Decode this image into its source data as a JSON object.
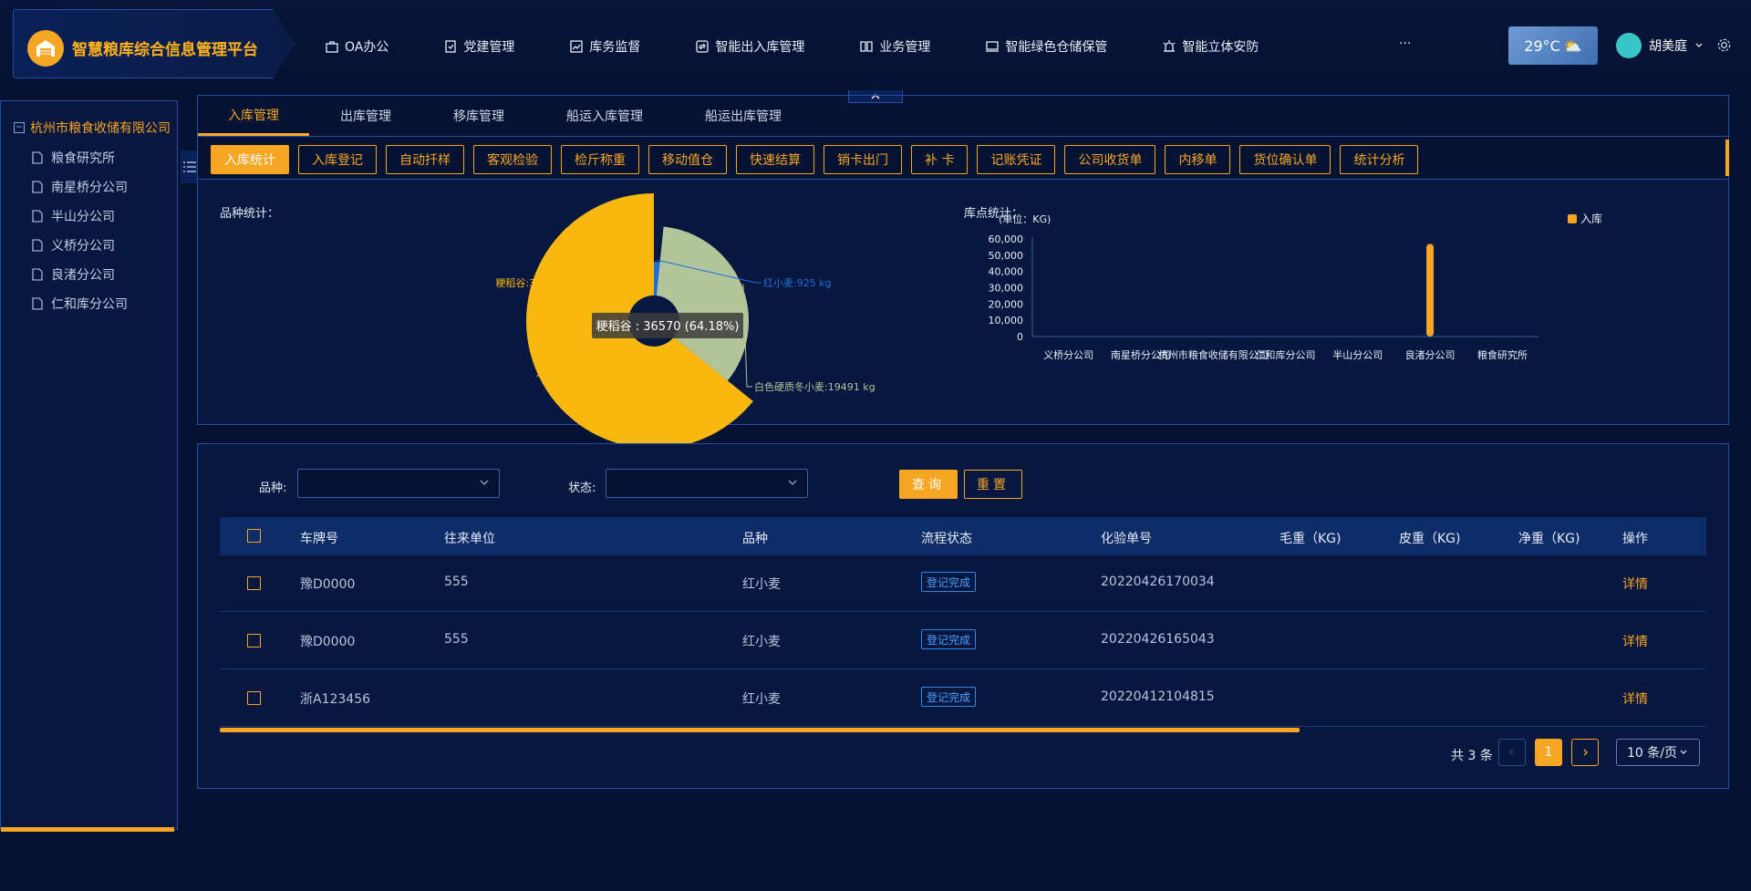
{
  "app": {
    "title": "智慧粮库综合信息管理平台"
  },
  "nav": {
    "items": [
      {
        "label": "OA办公",
        "icon": "briefcase-icon"
      },
      {
        "label": "党建管理",
        "icon": "shield-doc-icon"
      },
      {
        "label": "库务监督",
        "icon": "line-chart-icon"
      },
      {
        "label": "智能出入库管理",
        "icon": "exchange-icon",
        "active": true
      },
      {
        "label": "业务管理",
        "icon": "book-icon"
      },
      {
        "label": "智能绿色仓储保管",
        "icon": "monitor-icon"
      },
      {
        "label": "智能立体安防",
        "icon": "alarm-icon"
      }
    ],
    "more": "···"
  },
  "weather": {
    "temp": "29°C",
    "icon": "partly-cloudy-icon"
  },
  "user": {
    "name": "胡美庭"
  },
  "sidebar": {
    "root": "杭州市粮食收储有限公司",
    "items": [
      "粮食研究所",
      "南星桥分公司",
      "半山分公司",
      "义桥分公司",
      "良渚分公司",
      "仁和库分公司"
    ]
  },
  "tabs": [
    "入库管理",
    "出库管理",
    "移库管理",
    "船运入库管理",
    "船运出库管理"
  ],
  "subtabs": [
    "入库统计",
    "入库登记",
    "自动扦样",
    "客观检验",
    "检斤称重",
    "移动值仓",
    "快速结算",
    "销卡出门",
    "补 卡",
    "记账凭证",
    "公司收货单",
    "内移单",
    "货位确认单",
    "统计分析"
  ],
  "charts": {
    "variety_title": "品种统计：",
    "depot_title": "库点统计：",
    "tooltip": "粳稻谷 : 36570 (64.18%)"
  },
  "chart_data": [
    {
      "type": "pie",
      "title": "品种统计：",
      "slices": [
        {
          "name": "粳稻谷",
          "value": 36570,
          "unit": "kg",
          "color": "#f8b80f"
        },
        {
          "name": "红小麦",
          "value": 925,
          "unit": "kg",
          "color": "#1d6fd6"
        },
        {
          "name": "白色硬质冬小麦",
          "value": 19491,
          "unit": "kg",
          "color": "#b3c49a"
        }
      ]
    },
    {
      "type": "bar",
      "title": "库点统计：",
      "unit_label": "(单位：KG)",
      "legend": [
        "入库"
      ],
      "legend_position": "top-right",
      "categories": [
        "义桥分公司",
        "南星桥分公司",
        "杭州市粮食收储有限公司",
        "仁和库分公司",
        "半山分公司",
        "良渚分公司",
        "粮食研究所"
      ],
      "series": [
        {
          "name": "入库",
          "values": [
            0,
            0,
            0,
            0,
            0,
            56986,
            0
          ],
          "color": "#f6a623"
        }
      ],
      "yticks": [
        "60,000",
        "50,000",
        "40,000",
        "30,000",
        "20,000",
        "10,000",
        "0"
      ],
      "ylim": [
        0,
        60000
      ]
    }
  ],
  "filters": {
    "variety_label": "品种:",
    "status_label": "状态:",
    "query": "查询",
    "reset": "重置"
  },
  "table": {
    "headers": [
      "车牌号",
      "往来单位",
      "品种",
      "流程状态",
      "化验单号",
      "毛重（KG)",
      "皮重（KG)",
      "净重（KG)",
      "操作"
    ],
    "rows": [
      {
        "plate": "豫D0000",
        "unit": "555",
        "variety": "红小麦",
        "status": "登记完成",
        "lab_no": "20220426170034",
        "action": "详情"
      },
      {
        "plate": "豫D0000",
        "unit": "555",
        "variety": "红小麦",
        "status": "登记完成",
        "lab_no": "20220426165043",
        "action": "详情"
      },
      {
        "plate": "浙A123456",
        "unit": "",
        "variety": "红小麦",
        "status": "登记完成",
        "lab_no": "20220412104815",
        "action": "详情"
      }
    ]
  },
  "pagination": {
    "total": "共 3 条",
    "current": "1",
    "page_size": "10 条/页"
  }
}
